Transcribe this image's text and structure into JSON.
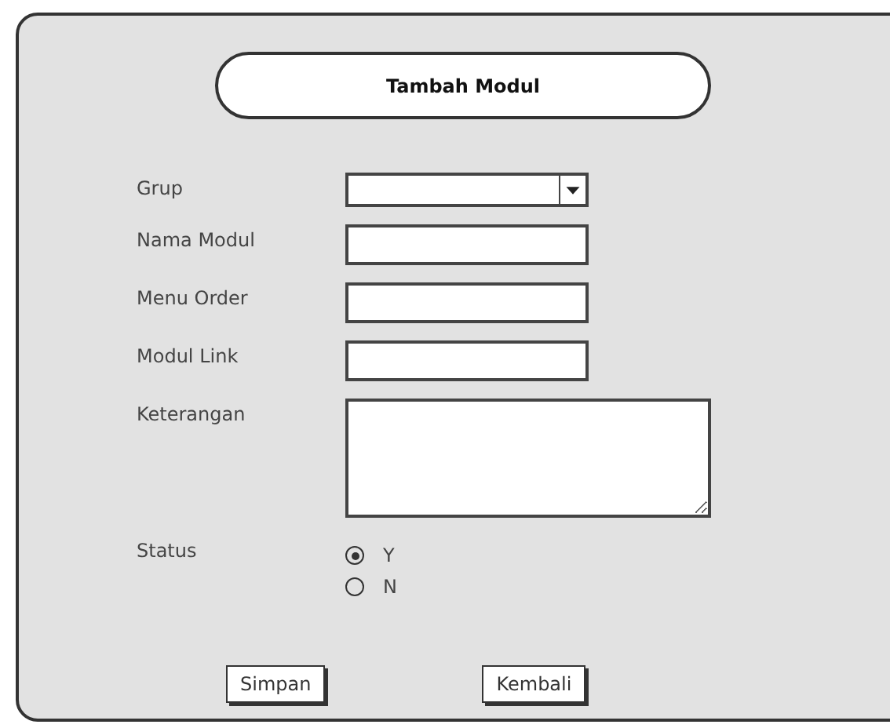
{
  "title": "Tambah Modul",
  "fields": [
    {
      "label": "Grup",
      "kind": "dropdown"
    },
    {
      "label": "Nama Modul",
      "kind": "text"
    },
    {
      "label": "Menu Order",
      "kind": "text"
    },
    {
      "label": "Modul Link",
      "kind": "text"
    },
    {
      "label": "Keterangan",
      "kind": "textarea"
    }
  ],
  "status": {
    "label": "Status",
    "options": [
      {
        "label": "Y",
        "selected": true
      },
      {
        "label": "N",
        "selected": false
      }
    ]
  },
  "buttons": [
    "Simpan",
    "Kembali"
  ]
}
